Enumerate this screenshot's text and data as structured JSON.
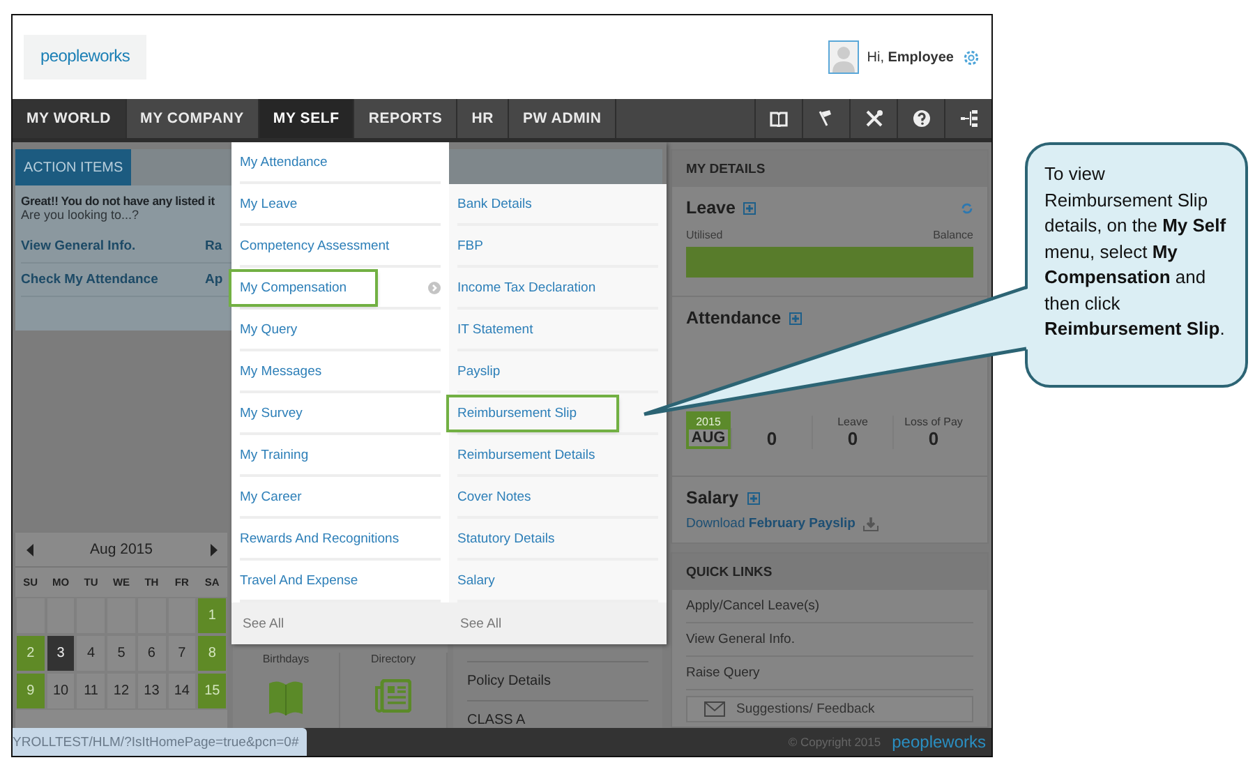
{
  "header": {
    "logo": "peopleworks",
    "greeting": "Hi, **Employee**"
  },
  "nav": {
    "tabs": [
      {
        "label": "MY WORLD",
        "selected": true,
        "open": false
      },
      {
        "label": "MY COMPANY",
        "selected": false,
        "open": false
      },
      {
        "label": "MY SELF",
        "selected": false,
        "open": true
      },
      {
        "label": "REPORTS",
        "selected": false,
        "open": false
      },
      {
        "label": "HR",
        "selected": false,
        "open": false
      },
      {
        "label": "PW ADMIN",
        "selected": false,
        "open": false
      }
    ]
  },
  "action_items": {
    "tab": "ACTION ITEMS",
    "message": "Great!! You do not have any listed it",
    "prompt": "Are you looking to...?",
    "links": [
      "View General Info.",
      "Ra",
      "Check My Attendance",
      "Ap"
    ]
  },
  "calendar": {
    "month": "Aug 2015",
    "weekdays": [
      "SU",
      "MO",
      "TU",
      "WE",
      "TH",
      "FR",
      "SA"
    ],
    "weeks": [
      [
        {
          "kind": "blank"
        },
        {
          "kind": "blank"
        },
        {
          "kind": "blank"
        },
        {
          "kind": "blank"
        },
        {
          "kind": "blank"
        },
        {
          "kind": "blank"
        },
        {
          "kind": "day",
          "day": "1",
          "weekend": true,
          "selected": false
        }
      ],
      [
        {
          "kind": "day",
          "day": "2",
          "weekend": true,
          "selected": false
        },
        {
          "kind": "day",
          "day": "3",
          "weekend": false,
          "selected": true
        },
        {
          "kind": "day",
          "day": "4",
          "weekend": false,
          "selected": false
        },
        {
          "kind": "day",
          "day": "5",
          "weekend": false,
          "selected": false
        },
        {
          "kind": "day",
          "day": "6",
          "weekend": false,
          "selected": false
        },
        {
          "kind": "day",
          "day": "7",
          "weekend": false,
          "selected": false
        },
        {
          "kind": "day",
          "day": "8",
          "weekend": true,
          "selected": false
        }
      ],
      [
        {
          "kind": "day",
          "day": "9",
          "weekend": true,
          "selected": false
        },
        {
          "kind": "day",
          "day": "10",
          "weekend": false,
          "selected": false
        },
        {
          "kind": "day",
          "day": "11",
          "weekend": false,
          "selected": false
        },
        {
          "kind": "day",
          "day": "12",
          "weekend": false,
          "selected": false
        },
        {
          "kind": "day",
          "day": "13",
          "weekend": false,
          "selected": false
        },
        {
          "kind": "day",
          "day": "14",
          "weekend": false,
          "selected": false
        },
        {
          "kind": "day",
          "day": "15",
          "weekend": true,
          "selected": false
        }
      ]
    ]
  },
  "widgets": [
    {
      "label": "Birthdays",
      "kind": "book"
    },
    {
      "label": "Directory",
      "kind": "news"
    }
  ],
  "policy": [
    "Policy Details",
    "CLASS A"
  ],
  "menu": {
    "items": [
      {
        "label": "My Attendance",
        "highlighted": false,
        "has_submenu": false
      },
      {
        "label": "My Leave",
        "highlighted": false,
        "has_submenu": false
      },
      {
        "label": "Competency Assessment",
        "highlighted": false,
        "has_submenu": false
      },
      {
        "label": "My Compensation",
        "highlighted": true,
        "has_submenu": true
      },
      {
        "label": "My Query",
        "highlighted": false,
        "has_submenu": false
      },
      {
        "label": "My Messages",
        "highlighted": false,
        "has_submenu": false
      },
      {
        "label": "My Survey",
        "highlighted": false,
        "has_submenu": false
      },
      {
        "label": "My Training",
        "highlighted": false,
        "has_submenu": false
      },
      {
        "label": "My Career",
        "highlighted": false,
        "has_submenu": false
      },
      {
        "label": "Rewards And Recognitions",
        "highlighted": false,
        "has_submenu": false
      },
      {
        "label": "Travel And Expense",
        "highlighted": false,
        "has_submenu": false
      }
    ],
    "see_all": "See All",
    "submenu": {
      "items": [
        {
          "label": "Bank Details",
          "highlighted": false
        },
        {
          "label": "FBP",
          "highlighted": false
        },
        {
          "label": "Income Tax Declaration",
          "highlighted": false
        },
        {
          "label": "IT Statement",
          "highlighted": false
        },
        {
          "label": "Payslip",
          "highlighted": false
        },
        {
          "label": "Reimbursement Slip",
          "highlighted": true
        },
        {
          "label": "Reimbursement Details",
          "highlighted": false
        },
        {
          "label": "Cover Notes",
          "highlighted": false
        },
        {
          "label": "Statutory Details",
          "highlighted": false
        },
        {
          "label": "Salary",
          "highlighted": false
        }
      ],
      "see_all": "See All"
    }
  },
  "my_details": {
    "title": "MY DETAILS",
    "leave": {
      "title": "Leave",
      "utilised_label": "Utilised",
      "balance_label": "Balance",
      "level": 1
    },
    "attendance": {
      "title": "Attendance",
      "year": "2015",
      "month": "AUG",
      "stats": [
        {
          "value": "0"
        },
        {
          "label": "Leave",
          "value": "0"
        },
        {
          "label": "Loss of Pay",
          "value": "0"
        }
      ]
    },
    "salary": {
      "title": "Salary",
      "link": "Download **February Payslip**"
    }
  },
  "quick_links": {
    "title": "QUICK LINKS",
    "items": [
      "Apply/Cancel Leave(s)",
      "View General Info.",
      "Raise Query"
    ],
    "feedback": "Suggestions/ Feedback"
  },
  "footer": {
    "status_url": "YROLLTEST/HLM/?IsItHomePage=true&pcn=0#",
    "copyright": "© Copyright 2015",
    "logo": "peopleworks"
  },
  "callout": {
    "text": "To view Reimbursement Slip details, on the **My Self** menu, select **My Compensation** and then click **Reimbursement Slip**."
  }
}
